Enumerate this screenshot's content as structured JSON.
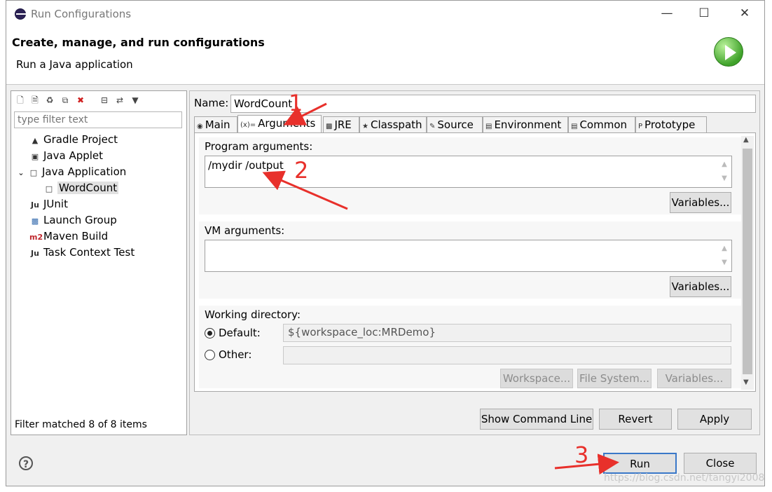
{
  "window": {
    "title": "Run Configurations"
  },
  "header": {
    "title": "Create, manage, and run configurations",
    "subtitle": "Run a Java application"
  },
  "left": {
    "filter_placeholder": "type filter text",
    "tree": [
      {
        "label": "Gradle Project",
        "icon": "gradle-icon"
      },
      {
        "label": "Java Applet",
        "icon": "java-applet-icon"
      },
      {
        "label": "Java Application",
        "icon": "java-application-icon",
        "expanded": true
      },
      {
        "label": "WordCount",
        "icon": "java-class-icon",
        "selected": true
      },
      {
        "label": "JUnit",
        "icon": "junit-icon"
      },
      {
        "label": "Launch Group",
        "icon": "launch-group-icon"
      },
      {
        "label": "Maven Build",
        "icon": "maven-icon"
      },
      {
        "label": "Task Context Test",
        "icon": "task-context-icon"
      }
    ],
    "filter_status": "Filter matched 8 of 8 items"
  },
  "config": {
    "name_label": "Name:",
    "name_value": "WordCount",
    "tabs": [
      "Main",
      "Arguments",
      "JRE",
      "Classpath",
      "Source",
      "Environment",
      "Common",
      "Prototype"
    ],
    "active_tab": "Arguments",
    "program_args_label": "Program arguments:",
    "program_args_value": "/mydir /output",
    "vm_args_label": "VM arguments:",
    "vm_args_value": "",
    "variables_label": "Variables...",
    "working_dir_label": "Working directory:",
    "default_label": "Default:",
    "default_value": "${workspace_loc:MRDemo}",
    "other_label": "Other:",
    "workspace_btn": "Workspace...",
    "filesystem_btn": "File System...",
    "variables_btn_disabled": "Variables..."
  },
  "actions": {
    "show_cmd": "Show Command Line",
    "revert": "Revert",
    "apply": "Apply",
    "run": "Run",
    "close": "Close"
  },
  "annotations": {
    "n1": "1",
    "n2": "2",
    "n3": "3"
  },
  "watermark": "https://blog.csdn.net/tangyi2008",
  "colors": {
    "annotation": "#e8302b",
    "selection": "#e1e1e1"
  }
}
